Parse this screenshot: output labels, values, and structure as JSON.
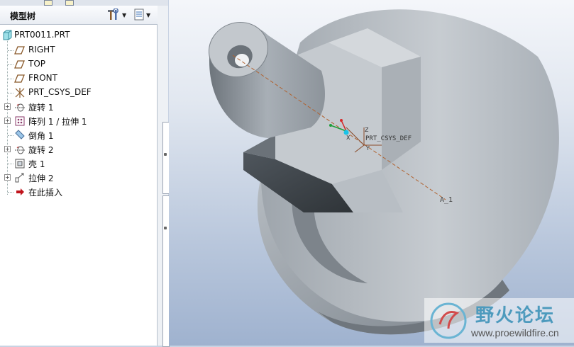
{
  "panel": {
    "title": "模型树",
    "settings_icon": "hammer-wrench-icon",
    "show_icon": "list-document-icon"
  },
  "tree": {
    "root": {
      "label": "PRT0011.PRT",
      "icon": "part-icon"
    },
    "items": [
      {
        "label": "RIGHT",
        "icon": "datum-plane-icon",
        "expandable": false
      },
      {
        "label": "TOP",
        "icon": "datum-plane-icon",
        "expandable": false
      },
      {
        "label": "FRONT",
        "icon": "datum-plane-icon",
        "expandable": false
      },
      {
        "label": "PRT_CSYS_DEF",
        "icon": "coordinate-system-icon",
        "expandable": false
      },
      {
        "label": "旋转 1",
        "icon": "revolve-icon",
        "expandable": true
      },
      {
        "label": "阵列 1 / 拉伸 1",
        "icon": "pattern-icon",
        "expandable": true
      },
      {
        "label": "倒角 1",
        "icon": "chamfer-icon",
        "expandable": false
      },
      {
        "label": "旋转 2",
        "icon": "revolve-icon",
        "expandable": true
      },
      {
        "label": "壳 1",
        "icon": "shell-icon",
        "expandable": false
      },
      {
        "label": "拉伸 2",
        "icon": "extrude-icon",
        "expandable": true
      },
      {
        "label": "在此插入",
        "icon": "insert-here-arrow-icon",
        "expandable": false
      }
    ]
  },
  "viewport": {
    "csys_label": "PRT_CSYS_DEF",
    "axis_label": "A_1",
    "axis_x_label": "X",
    "axis_y_label": "Y",
    "axis_z_label": "Z",
    "colors": {
      "model": "#a6adb4",
      "axis_line": "#b0622f",
      "background_top": "#f4f6fa",
      "background_bottom": "#9fb2cf"
    }
  },
  "watermark": {
    "title": "野火论坛",
    "url": "www.proewildfire.cn"
  }
}
